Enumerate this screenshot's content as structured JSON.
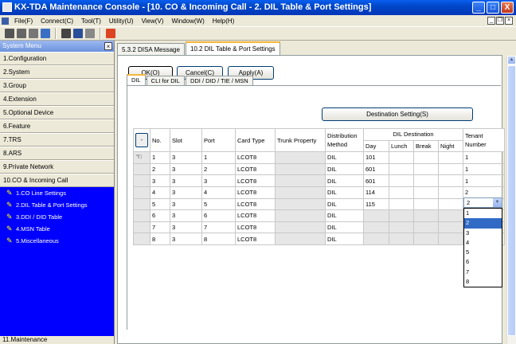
{
  "window": {
    "title": "KX-TDA Maintenance Console - [10. CO & Incoming Call - 2. DIL Table & Port Settings]",
    "controls": [
      "_",
      "□",
      "X"
    ]
  },
  "menu": [
    "File(F)",
    "Connect(C)",
    "Tool(T)",
    "Utility(U)",
    "View(V)",
    "Window(W)",
    "Help(H)"
  ],
  "sidebar": {
    "title": "System Menu",
    "sections": [
      "1.Configuration",
      "2.System",
      "3.Group",
      "4.Extension",
      "5.Optional Device",
      "6.Feature",
      "7.TRS",
      "8.ARS",
      "9.Private Network",
      "10.CO & Incoming Call"
    ],
    "subitems": [
      "1.CO Line Settings",
      "2.DIL Table & Port Settings",
      "3.DDI / DID Table",
      "4.MSN Table",
      "5.Miscellaneous"
    ],
    "footer": "11.Maintenance"
  },
  "tabs": {
    "top": [
      "5.3.2 DISA Message",
      "10.2 DIL Table & Port Settings"
    ],
    "sub": [
      "DIL",
      "CLI for DIL",
      "DDI / DID / TIE / MSN"
    ]
  },
  "buttons": {
    "ok": "OK(O)",
    "cancel": "Cancel(C)",
    "apply": "Apply(A)",
    "destination": "Destination Setting(S)",
    "minus": "-"
  },
  "table": {
    "headers": {
      "no": "No.",
      "slot": "Slot",
      "port": "Port",
      "card_type": "Card Type",
      "trunk_property": "Trunk Property",
      "distribution_method": [
        "Distribution",
        "Method"
      ],
      "dil_destination": "DIL Destination",
      "day": "Day",
      "lunch": "Lunch",
      "break": "Break",
      "night": "Night",
      "tenant_number": [
        "Tenant",
        "Number"
      ]
    },
    "rows": [
      {
        "no": "1",
        "slot": "3",
        "port": "1",
        "card": "LCOT8",
        "method": "DIL",
        "day": "101",
        "tenant": "1"
      },
      {
        "no": "2",
        "slot": "3",
        "port": "2",
        "card": "LCOT8",
        "method": "DIL",
        "day": "601",
        "tenant": "1"
      },
      {
        "no": "3",
        "slot": "3",
        "port": "3",
        "card": "LCOT8",
        "method": "DIL",
        "day": "601",
        "tenant": "1"
      },
      {
        "no": "4",
        "slot": "3",
        "port": "4",
        "card": "LCOT8",
        "method": "DIL",
        "day": "114",
        "tenant": "2"
      },
      {
        "no": "5",
        "slot": "3",
        "port": "5",
        "card": "LCOT8",
        "method": "DIL",
        "day": "115",
        "tenant": ""
      },
      {
        "no": "6",
        "slot": "3",
        "port": "6",
        "card": "LCOT8",
        "method": "DIL",
        "day": "",
        "tenant": ""
      },
      {
        "no": "7",
        "slot": "3",
        "port": "7",
        "card": "LCOT8",
        "method": "DIL",
        "day": "",
        "tenant": ""
      },
      {
        "no": "8",
        "slot": "3",
        "port": "8",
        "card": "LCOT8",
        "method": "DIL",
        "day": "",
        "tenant": ""
      }
    ]
  },
  "tenant_dropdown": {
    "value": "2",
    "options": [
      "1",
      "2",
      "3",
      "4",
      "5",
      "6",
      "7",
      "8"
    ],
    "highlighted": "2"
  }
}
